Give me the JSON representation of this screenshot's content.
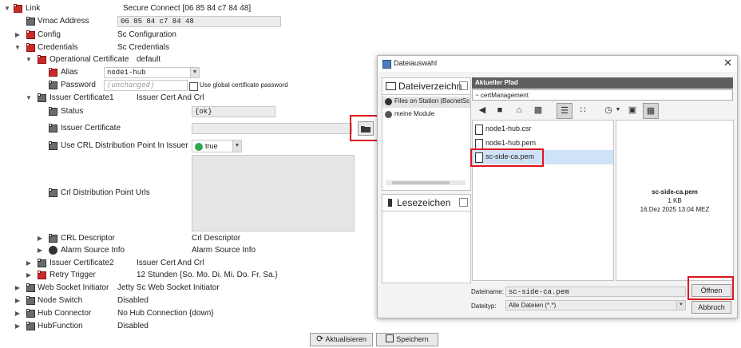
{
  "tree": {
    "link": {
      "label": "Link",
      "value": "Secure Connect [06 85 84 c7 84 48]"
    },
    "vmac": {
      "label": "Vmac Address",
      "value": "06 85 84 c7 84 48"
    },
    "config": {
      "label": "Config",
      "value": "Sc Configuration"
    },
    "credentials": {
      "label": "Credentials",
      "value": "Sc Credentials"
    },
    "op_cert": {
      "label": "Operational Certificate",
      "value": "default"
    },
    "alias": {
      "label": "Alias",
      "value": "node1-hub"
    },
    "password": {
      "label": "Password",
      "placeholder": "(unchanged)",
      "global_label": "Use global certificate password"
    },
    "issuer1": {
      "label": "Issuer Certificate1",
      "value": "Issuer Cert And Crl"
    },
    "status": {
      "label": "Status",
      "value": "{ok}"
    },
    "issuer_cert": {
      "label": "Issuer Certificate"
    },
    "crl_use": {
      "label": "Use CRL Distribution Point In Issuer",
      "value": "true"
    },
    "crl_urls": {
      "label": "Crl Distribution Point Urls"
    },
    "crl_desc": {
      "label": "CRL Descriptor",
      "value": "Crl Descriptor"
    },
    "alarm_src": {
      "label": "Alarm Source Info",
      "value": "Alarm Source Info"
    },
    "issuer2": {
      "label": "Issuer Certificate2",
      "value": "Issuer Cert And Crl"
    },
    "retry": {
      "label": "Retry Trigger",
      "value": "12 Stunden {So. Mo. Di. Mi. Do. Fr. Sa.}"
    },
    "ws_init": {
      "label": "Web Socket Initiator",
      "value": "Jetty Sc Web Socket Initiator"
    },
    "node_switch": {
      "label": "Node Switch",
      "value": "Disabled"
    },
    "hub_conn": {
      "label": "Hub Connector",
      "value": "No Hub Connection {down}"
    },
    "hub_func": {
      "label": "HubFunction",
      "value": "Disabled"
    }
  },
  "footer": {
    "refresh": "Aktualisieren",
    "save": "Speichern"
  },
  "dialog": {
    "title": "Dateiauswahl",
    "left_header": "Dateiverzeichn",
    "roots": [
      "Files on Station (BacnetSc",
      "meine Module"
    ],
    "bookmarks": "Lesezeichen",
    "path_header": "Aktueller Pfad",
    "path_value": "~ certManagement",
    "files": [
      "node1-hub.csr",
      "node1-hub.pem",
      "sc-side-ca.pem"
    ],
    "preview": {
      "name": "sc-side-ca.pem",
      "size": "1 KB",
      "date": "16.Dez 2025 13:04 MEZ"
    },
    "filename_label": "Dateiname:",
    "filename_value": "sc-side-ca.pem",
    "filetype_label": "Dateityp:",
    "filetype_value": "Alle Dateien (*.*)",
    "open": "Öffnen",
    "cancel": "Abbruch"
  },
  "colors": {
    "accent_red": "#e0141e",
    "brick": "#c92b2b",
    "header_bar": "#5f5f5f",
    "selection": "#cfe3f8",
    "status_green": "#2fa84f"
  },
  "icons": [
    "brick-icon",
    "folder-icon",
    "close-icon",
    "back-icon",
    "home-icon",
    "list-view-icon",
    "details-view-icon",
    "history-icon",
    "save-icon",
    "certificate-file-icon",
    "globe-icon",
    "pin-icon",
    "refresh-icon"
  ]
}
